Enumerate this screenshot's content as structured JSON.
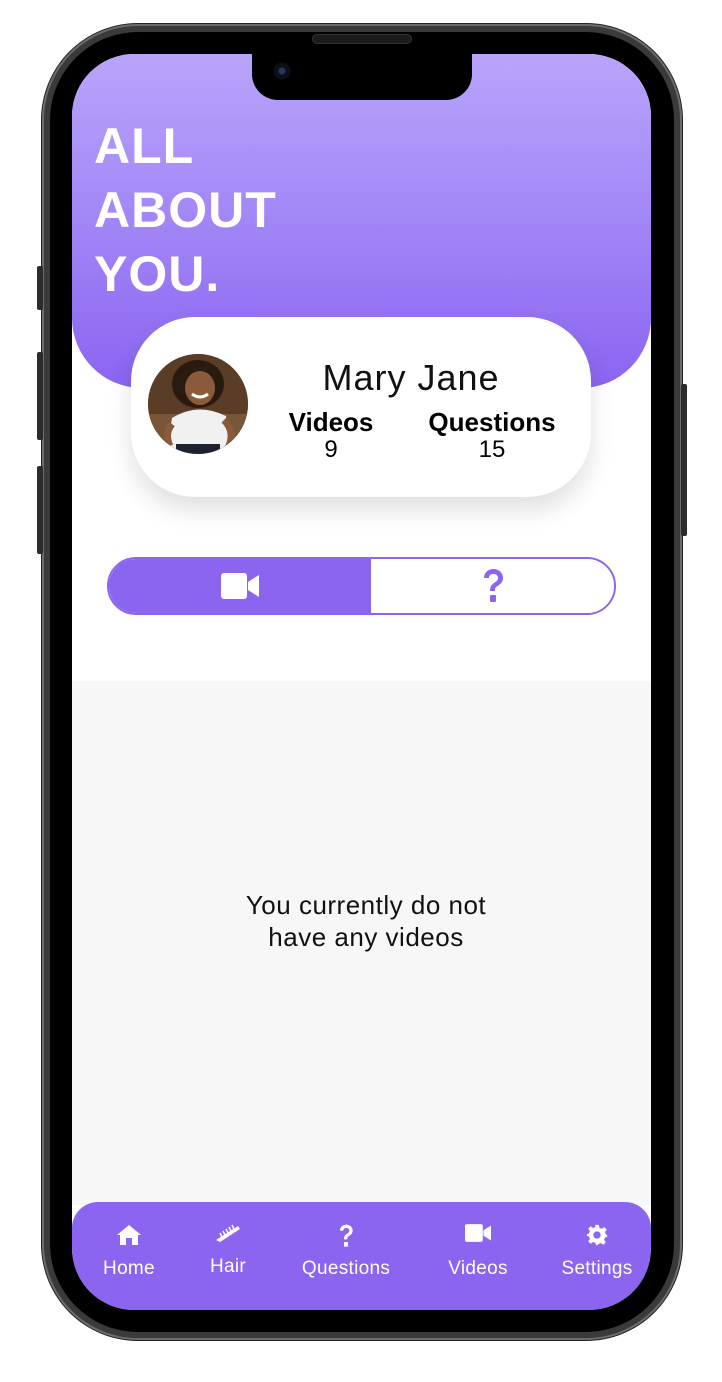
{
  "header": {
    "headline_lines": [
      "ALL",
      "ABOUT",
      "YOU."
    ]
  },
  "profile": {
    "name": "Mary Jane",
    "stats": {
      "videos_label": "Videos",
      "videos_value": "9",
      "questions_label": "Questions",
      "questions_value": "15"
    }
  },
  "toggle": {
    "selected": "videos",
    "options": [
      {
        "icon": "video-camera-icon"
      },
      {
        "icon": "question-mark-icon"
      }
    ]
  },
  "content": {
    "empty_lines": [
      "You currently do not",
      "have any videos"
    ]
  },
  "nav": {
    "items": [
      {
        "label": "Home",
        "icon": "home-icon"
      },
      {
        "label": "Hair",
        "icon": "comb-icon"
      },
      {
        "label": "Questions",
        "icon": "question-mark-icon"
      },
      {
        "label": "Videos",
        "icon": "video-camera-icon"
      },
      {
        "label": "Settings",
        "icon": "gear-icon"
      }
    ]
  },
  "colors": {
    "accent": "#8b65f0",
    "header_top": "#baa4fb",
    "content_bg": "#f7f7f7"
  }
}
